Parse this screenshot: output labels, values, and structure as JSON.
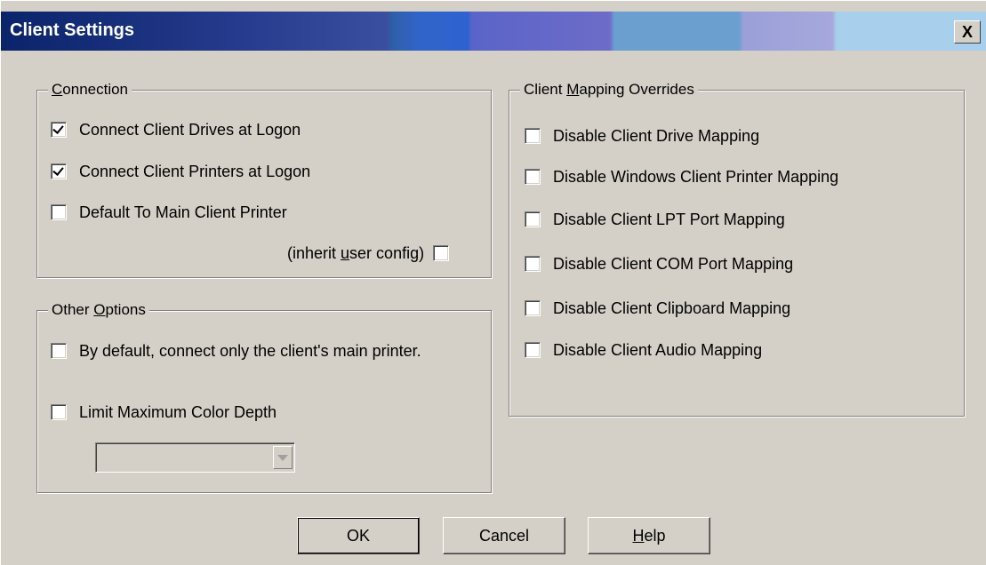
{
  "window": {
    "title": "Client Settings",
    "close_label": "X"
  },
  "connection": {
    "legend_prefix": "",
    "legend_key": "C",
    "legend_rest": "onnection",
    "items": [
      {
        "label": "Connect Client Drives at Logon",
        "checked": true
      },
      {
        "label": "Connect Client Printers at Logon",
        "checked": true
      },
      {
        "label": "Default To Main Client Printer",
        "checked": false
      }
    ],
    "inherit": {
      "prefix": "(inherit ",
      "key": "u",
      "rest": "ser config)",
      "checked": false
    }
  },
  "other_options": {
    "legend_prefix": "Other ",
    "legend_key": "O",
    "legend_rest": "ptions",
    "items": [
      {
        "label": "By default, connect only the client's main printer.",
        "checked": false
      },
      {
        "label": "Limit Maximum Color Depth",
        "checked": false
      }
    ],
    "color_depth": {
      "value": "",
      "enabled": false
    }
  },
  "mapping_overrides": {
    "legend_prefix": "Client ",
    "legend_key": "M",
    "legend_rest": "apping Overrides",
    "items": [
      {
        "label": "Disable Client Drive Mapping",
        "checked": false
      },
      {
        "label": "Disable Windows Client Printer Mapping",
        "checked": false
      },
      {
        "label": "Disable Client LPT Port Mapping",
        "checked": false
      },
      {
        "label": "Disable Client COM Port Mapping",
        "checked": false
      },
      {
        "label": "Disable Client Clipboard Mapping",
        "checked": false
      },
      {
        "label": "Disable Client Audio Mapping",
        "checked": false
      }
    ]
  },
  "buttons": {
    "ok": "OK",
    "cancel": "Cancel",
    "help_key": "H",
    "help_rest": "elp"
  }
}
